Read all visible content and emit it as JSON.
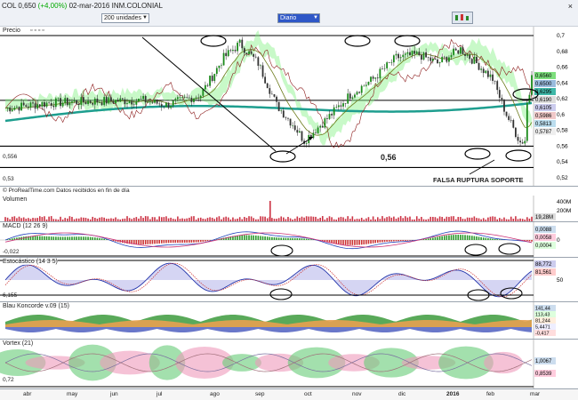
{
  "header": {
    "symbol": "COL",
    "price": "0,650",
    "change": "(+4,00%)",
    "date": "02-mar-2016",
    "name": "INM.COLONIAL",
    "units_value": "200 unidades",
    "period_value": "Diario",
    "close_glyph": "×"
  },
  "panels": {
    "precio": {
      "label": "Precio",
      "ticks": [
        "0,7",
        "0,68",
        "0,66",
        "0,64",
        "0,62",
        "0,6",
        "0,58",
        "0,56",
        "0,54",
        "0,52"
      ],
      "tags": [
        "0,6560",
        "0,6500",
        "0,6295",
        "0,6190",
        "0,6105",
        "0,5986",
        "0,5813",
        "0,5787"
      ],
      "left_label_bottom": "0,53",
      "left_label_mid": "0,556",
      "annotation_level": "0,56",
      "annotation_text": "FALSA RUPTURA SOPORTE",
      "source": "© ProRealTime.com  Datos recibidos en fin de día"
    },
    "volumen": {
      "label": "Volumen",
      "ticks": [
        "400M",
        "200M"
      ],
      "tags": [
        "19,28M"
      ]
    },
    "macd": {
      "label": "MACD (12 26 9)",
      "ticks": [
        "0"
      ],
      "tags": [
        "0,0088",
        "0,0058",
        "0,0004"
      ],
      "left_label": "-0,022"
    },
    "estocastico": {
      "label": "Estocástico (14 3 5)",
      "ticks": [
        "50"
      ],
      "tags": [
        "88,772",
        "81,561"
      ],
      "left_label": "6,155"
    },
    "blau": {
      "label": "Blau Koncorde v.09 (15)",
      "tags": [
        "141,44",
        "113,43",
        "81,244",
        "5,4471",
        "-0,417"
      ]
    },
    "vortex": {
      "label": "Vortex (21)",
      "tags": [
        "1,0067",
        "0,8539"
      ],
      "left_label": "0,72"
    }
  },
  "xaxis": {
    "labels": [
      "abr",
      "may",
      "jun",
      "jul",
      "ago",
      "sep",
      "oct",
      "nov",
      "dic",
      "2016",
      "feb",
      "mar"
    ]
  },
  "colors": {
    "accent": "#2e57c7",
    "up": "#00aa00",
    "candle_up": "#1a8a1a",
    "candle_down": "#333333",
    "ma": "#1e9e8f",
    "cloud": "#66ee66"
  }
}
